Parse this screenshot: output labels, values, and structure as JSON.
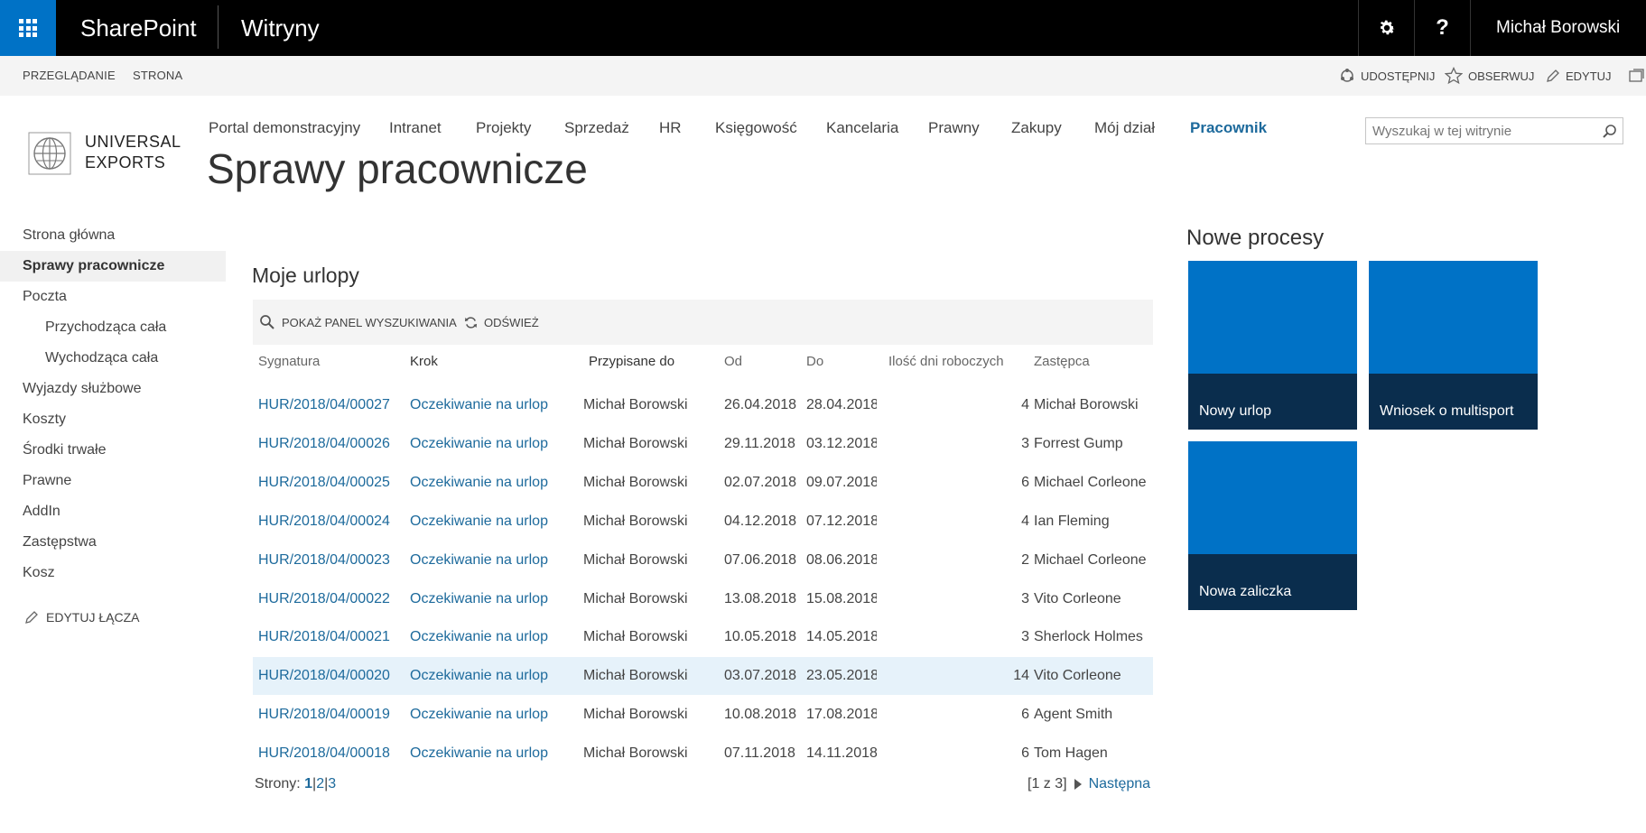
{
  "suitebar": {
    "brand": "SharePoint",
    "sites": "Witryny",
    "help": "?",
    "user": "Michał Borowski"
  },
  "ribbon": {
    "tabs": [
      "PRZEGLĄDANIE",
      "STRONA"
    ],
    "actions": {
      "share": "UDOSTĘPNIJ",
      "follow": "OBSERWUJ",
      "edit": "EDYTUJ"
    }
  },
  "header": {
    "logo_line1": "UNIVERSAL",
    "logo_line2": "EXPORTS",
    "page_title": "Sprawy pracownicze",
    "search_placeholder": "Wyszukaj w tej witrynie",
    "nav": [
      "Portal demonstracyjny",
      "Intranet",
      "Projekty",
      "Sprzedaż",
      "HR",
      "Księgowość",
      "Kancelaria",
      "Prawny",
      "Zakupy",
      "Mój dział",
      "Pracownik"
    ],
    "active_nav": "Pracownik"
  },
  "leftnav": {
    "items": [
      "Strona główna",
      "Sprawy pracownicze",
      "Poczta",
      "Przychodząca cała",
      "Wychodząca cała",
      "Wyjazdy służbowe",
      "Koszty",
      "Środki trwałe",
      "Prawne",
      "AddIn",
      "Zastępstwa",
      "Kosz"
    ],
    "selected": "Sprawy pracownicze",
    "edit_links": "EDYTUJ ŁĄCZA"
  },
  "list": {
    "title": "Moje urlopy",
    "toolbar": {
      "search_panel": "POKAŻ PANEL WYSZUKIWANIA",
      "refresh": "ODŚWIEŻ"
    },
    "columns": [
      "Sygnatura",
      "Krok",
      "Przypisane do",
      "Od",
      "Do",
      "Ilość dni roboczych",
      "Zastępca"
    ],
    "rows": [
      {
        "sig": "HUR/2018/04/00027",
        "step": "Oczekiwanie na urlop",
        "assigned": "Michał Borowski",
        "from": "26.04.2018",
        "to": "28.04.2018",
        "days": "4",
        "sub": "Michał Borowski"
      },
      {
        "sig": "HUR/2018/04/00026",
        "step": "Oczekiwanie na urlop",
        "assigned": "Michał Borowski",
        "from": "29.11.2018",
        "to": "03.12.2018",
        "days": "3",
        "sub": "Forrest Gump"
      },
      {
        "sig": "HUR/2018/04/00025",
        "step": "Oczekiwanie na urlop",
        "assigned": "Michał Borowski",
        "from": "02.07.2018",
        "to": "09.07.2018",
        "days": "6",
        "sub": "Michael Corleone"
      },
      {
        "sig": "HUR/2018/04/00024",
        "step": "Oczekiwanie na urlop",
        "assigned": "Michał Borowski",
        "from": "04.12.2018",
        "to": "07.12.2018",
        "days": "4",
        "sub": "Ian Fleming"
      },
      {
        "sig": "HUR/2018/04/00023",
        "step": "Oczekiwanie na urlop",
        "assigned": "Michał Borowski",
        "from": "07.06.2018",
        "to": "08.06.2018",
        "days": "2",
        "sub": "Michael Corleone"
      },
      {
        "sig": "HUR/2018/04/00022",
        "step": "Oczekiwanie na urlop",
        "assigned": "Michał Borowski",
        "from": "13.08.2018",
        "to": "15.08.2018",
        "days": "3",
        "sub": "Vito Corleone"
      },
      {
        "sig": "HUR/2018/04/00021",
        "step": "Oczekiwanie na urlop",
        "assigned": "Michał Borowski",
        "from": "10.05.2018",
        "to": "14.05.2018",
        "days": "3",
        "sub": "Sherlock Holmes"
      },
      {
        "sig": "HUR/2018/04/00020",
        "step": "Oczekiwanie na urlop",
        "assigned": "Michał Borowski",
        "from": "03.07.2018",
        "to": "23.05.2018",
        "days": "14",
        "sub": "Vito Corleone"
      },
      {
        "sig": "HUR/2018/04/00019",
        "step": "Oczekiwanie na urlop",
        "assigned": "Michał Borowski",
        "from": "10.08.2018",
        "to": "17.08.2018",
        "days": "6",
        "sub": "Agent Smith"
      },
      {
        "sig": "HUR/2018/04/00018",
        "step": "Oczekiwanie na urlop",
        "assigned": "Michał Borowski",
        "from": "07.11.2018",
        "to": "14.11.2018",
        "days": "6",
        "sub": "Tom Hagen"
      }
    ],
    "highlighted_row": 8,
    "pager": {
      "label": "Strony:",
      "pages": [
        "1",
        "2",
        "3"
      ],
      "current": "1",
      "range": "[1 z 3]",
      "next": "Następna"
    }
  },
  "tiles": {
    "title": "Nowe procesy",
    "items": [
      "Nowy urlop",
      "Wniosek o multisport",
      "Nowa zaliczka"
    ]
  },
  "colors": {
    "accent": "#0072c6",
    "link": "#1d6a9c",
    "tile_label_bg": "#0a2d4d",
    "row_highlight": "#e6f2fa"
  }
}
